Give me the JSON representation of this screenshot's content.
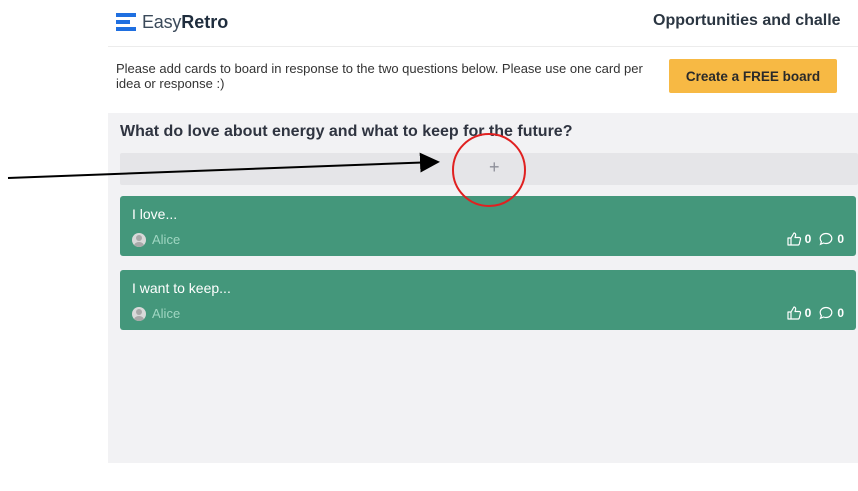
{
  "header": {
    "logo_light": "Easy",
    "logo_bold": "Retro",
    "board_title": "Opportunities and challe"
  },
  "notice": {
    "text": "Please add cards to board in response to the two questions below. Please use one card per idea or response :)",
    "cta_label": "Create a FREE board"
  },
  "column": {
    "title": "What do love about energy and what to keep for the future?",
    "add_symbol": "+"
  },
  "cards": [
    {
      "text": "I love...",
      "author": "Alice",
      "votes": "0",
      "comments": "0"
    },
    {
      "text": "I want to keep...",
      "author": "Alice",
      "votes": "0",
      "comments": "0"
    }
  ],
  "colors": {
    "brand": "#1f6fe0",
    "cta": "#f7b944",
    "card": "#44977b",
    "annotation_circle": "#e02020",
    "annotation_arrow": "#000000"
  },
  "icons": [
    "easyretro-logo-icon",
    "plus-icon",
    "avatar-icon",
    "thumbs-up-icon",
    "comment-icon"
  ]
}
